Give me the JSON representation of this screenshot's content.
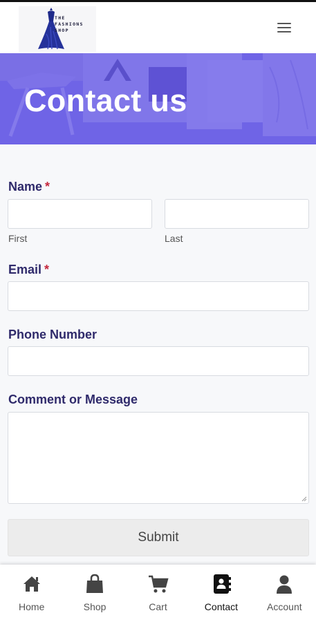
{
  "header": {
    "logo_lines": [
      "THE",
      "FASHIONS",
      "SHOP"
    ],
    "logo_alt": "The Fashions Shop logo",
    "menu_icon": "hamburger-menu-icon"
  },
  "hero": {
    "title": "Contact us"
  },
  "form": {
    "name_label": "Name",
    "required_mark": "*",
    "first_sublabel": "First",
    "last_sublabel": "Last",
    "first_value": "",
    "last_value": "",
    "email_label": "Email",
    "email_value": "",
    "phone_label": "Phone Number",
    "phone_value": "",
    "message_label": "Comment or Message",
    "message_value": "",
    "submit_label": "Submit"
  },
  "colors": {
    "accent": "#6a5de8",
    "label_text": "#2f2a6b",
    "required": "#c5283d"
  },
  "bottom_nav": {
    "items": [
      {
        "label": "Home",
        "icon": "home-icon",
        "active": false
      },
      {
        "label": "Shop",
        "icon": "shopping-bag-icon",
        "active": false
      },
      {
        "label": "Cart",
        "icon": "cart-icon",
        "active": false
      },
      {
        "label": "Contact",
        "icon": "contact-book-icon",
        "active": true
      },
      {
        "label": "Account",
        "icon": "user-icon",
        "active": false
      }
    ]
  }
}
